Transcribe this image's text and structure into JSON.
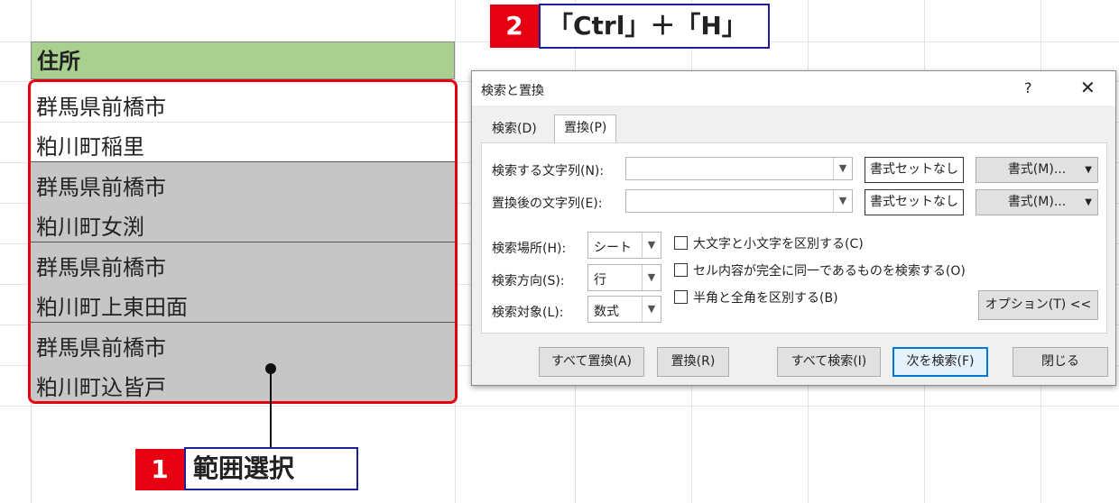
{
  "sheet": {
    "header": "住所",
    "cells": [
      {
        "line1": "群馬県前橋市",
        "line2": "粕川町稲里",
        "selected": false
      },
      {
        "line1": "群馬県前橋市",
        "line2": "粕川町女渕",
        "selected": true
      },
      {
        "line1": "群馬県前橋市",
        "line2": "粕川町上東田面",
        "selected": true
      },
      {
        "line1": "群馬県前橋市",
        "line2": "粕川町込皆戸",
        "selected": true
      }
    ]
  },
  "callouts": {
    "step1": {
      "number": "1",
      "text": "範囲選択"
    },
    "step2": {
      "number": "2",
      "text": "「Ctrl」＋「H」"
    }
  },
  "dialog": {
    "title": "検索と置換",
    "help": "?",
    "close": "✕",
    "tabs": {
      "search": "検索(D)",
      "replace": "置換(P)"
    },
    "find_label": "検索する文字列(N):",
    "find_value": "",
    "replace_label": "置換後の文字列(E):",
    "replace_value": "",
    "no_format_1": "書式セットなし",
    "no_format_2": "書式セットなし",
    "format_1": "書式(M)...",
    "format_2": "書式(M)...",
    "within_label": "検索場所(H):",
    "within_value": "シート",
    "direction_label": "検索方向(S):",
    "direction_value": "行",
    "lookin_label": "検索対象(L):",
    "lookin_value": "数式",
    "opt_case": "大文字と小文字を区別する(C)",
    "opt_whole": "セル内容が完全に同一であるものを検索する(O)",
    "opt_width": "半角と全角を区別する(B)",
    "options_btn": "オプション(T) <<",
    "replace_all": "すべて置換(A)",
    "replace": "置換(R)",
    "find_all": "すべて検索(I)",
    "find_next": "次を検索(F)",
    "close_btn": "閉じる"
  }
}
